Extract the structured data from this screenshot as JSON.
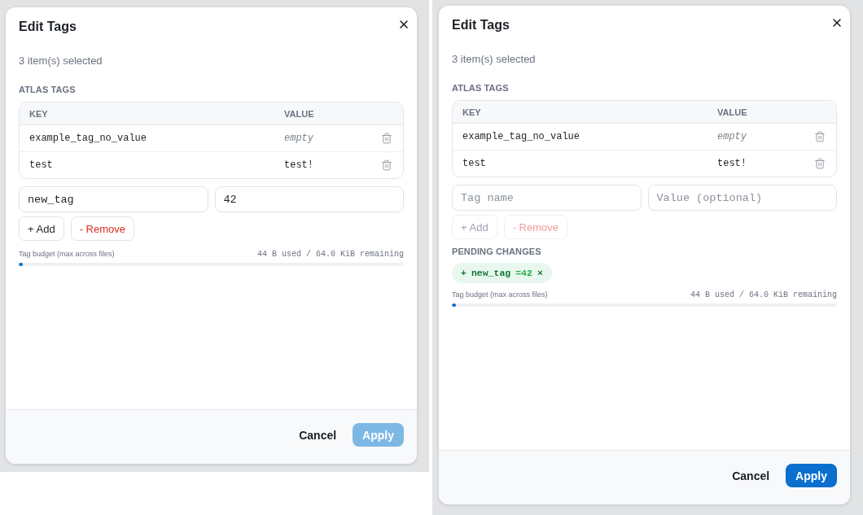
{
  "screens": [
    {
      "dialog": {
        "title": "Edit Tags",
        "subtitle": "3 item(s) selected",
        "tags_section": {
          "title": "ATLAS TAGS",
          "columns": [
            "KEY",
            "VALUE"
          ],
          "rows": [
            {
              "key": "example_tag_no_value",
              "value": "empty",
              "empty": true
            },
            {
              "key": "test",
              "value": "test!",
              "empty": false
            }
          ]
        },
        "new_tag": {
          "name_field": {
            "value": "new_tag"
          },
          "value_field": {
            "value": "42"
          }
        },
        "actions": [
          {
            "kind": "add",
            "label": "+ Add",
            "disabled": false
          },
          {
            "kind": "remove",
            "label": "- Remove",
            "disabled": false
          }
        ],
        "budget": {
          "label": "Tag budget (max across files)",
          "reading": "44 B used / 64.0 KiB remaining",
          "level": 0.001
        },
        "footer": {
          "buttons": [
            {
              "kind": "cancel",
              "label": "Cancel",
              "disabled": false
            },
            {
              "kind": "apply",
              "label": "Apply",
              "disabled": true
            }
          ]
        }
      }
    },
    {
      "dialog": {
        "title": "Edit Tags",
        "subtitle": "3 item(s) selected",
        "tags_section": {
          "title": "ATLAS TAGS",
          "columns": [
            "KEY",
            "VALUE"
          ],
          "rows": [
            {
              "key": "example_tag_no_value",
              "value": "empty",
              "empty": true
            },
            {
              "key": "test",
              "value": "test!",
              "empty": false
            }
          ]
        },
        "new_tag": {
          "name_field": {
            "placeholder": "Tag name"
          },
          "value_field": {
            "placeholder": "Value (optional)"
          }
        },
        "actions": [
          {
            "kind": "add",
            "label": "+ Add",
            "disabled": true
          },
          {
            "kind": "remove",
            "label": "- Remove",
            "disabled": true
          }
        ],
        "pending": {
          "title": "PENDING CHANGES",
          "items": [
            {
              "kind": "add",
              "sign": "+",
              "key": "new_tag",
              "value": "=42",
              "remove": "×"
            }
          ]
        },
        "budget": {
          "label": "Tag budget (max across files)",
          "reading": "44 B used / 64.0 KiB remaining",
          "level": 0.001
        },
        "footer": {
          "buttons": [
            {
              "kind": "cancel",
              "label": "Cancel",
              "disabled": false
            },
            {
              "kind": "apply",
              "label": "Apply",
              "disabled": false
            }
          ]
        }
      }
    }
  ]
}
